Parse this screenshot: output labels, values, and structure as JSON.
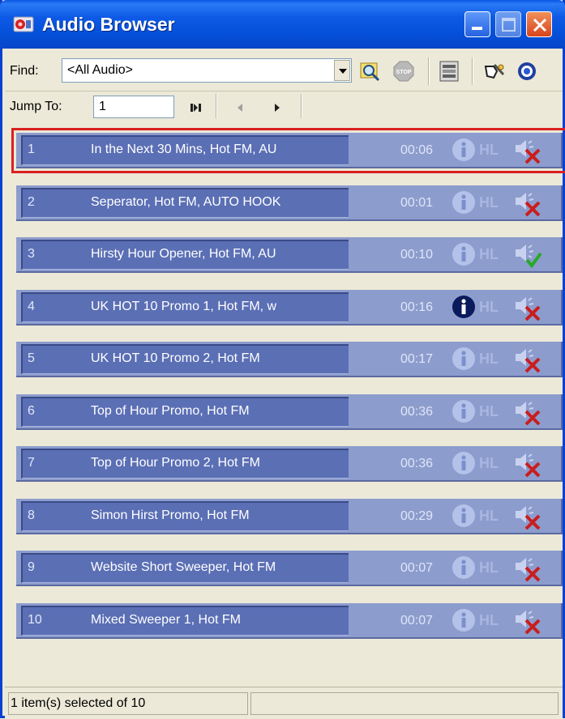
{
  "window": {
    "title": "Audio Browser"
  },
  "find": {
    "label": "Find:",
    "value": "<All Audio>"
  },
  "jump": {
    "label": "Jump To:",
    "value": "1"
  },
  "items": [
    {
      "num": "1",
      "title": "In the Next 30 Mins, Hot FM, AU",
      "duration": "00:06",
      "hl": "HL",
      "info_active": false,
      "status": "muted",
      "selected": true
    },
    {
      "num": "2",
      "title": "Seperator, Hot FM, AUTO HOOK",
      "duration": "00:01",
      "hl": "HL",
      "info_active": false,
      "status": "muted",
      "selected": false
    },
    {
      "num": "3",
      "title": "Hirsty Hour Opener, Hot FM, AU",
      "duration": "00:10",
      "hl": "HL",
      "info_active": false,
      "status": "ok",
      "selected": false
    },
    {
      "num": "4",
      "title": "UK HOT 10 Promo 1, Hot FM, w",
      "duration": "00:16",
      "hl": "HL",
      "info_active": true,
      "status": "muted",
      "selected": false
    },
    {
      "num": "5",
      "title": "UK HOT 10 Promo 2, Hot FM",
      "duration": "00:17",
      "hl": "HL",
      "info_active": false,
      "status": "muted",
      "selected": false
    },
    {
      "num": "6",
      "title": "Top of Hour Promo, Hot FM",
      "duration": "00:36",
      "hl": "HL",
      "info_active": false,
      "status": "muted",
      "selected": false
    },
    {
      "num": "7",
      "title": "Top of Hour Promo 2, Hot FM",
      "duration": "00:36",
      "hl": "HL",
      "info_active": false,
      "status": "muted",
      "selected": false
    },
    {
      "num": "8",
      "title": "Simon Hirst Promo, Hot FM",
      "duration": "00:29",
      "hl": "HL",
      "info_active": false,
      "status": "muted",
      "selected": false
    },
    {
      "num": "9",
      "title": "Website Short Sweeper, Hot FM",
      "duration": "00:07",
      "hl": "HL",
      "info_active": false,
      "status": "muted",
      "selected": false
    },
    {
      "num": "10",
      "title": "Mixed Sweeper 1, Hot FM",
      "duration": "00:07",
      "hl": "HL",
      "info_active": false,
      "status": "muted",
      "selected": false
    }
  ],
  "status": {
    "text": "1 item(s) selected of 10"
  },
  "colors": {
    "titlebar": "#0a55e4",
    "row_bg": "#8c9ccd",
    "cell_bg": "#5b6fb5",
    "selection_outline": "#d92020"
  }
}
